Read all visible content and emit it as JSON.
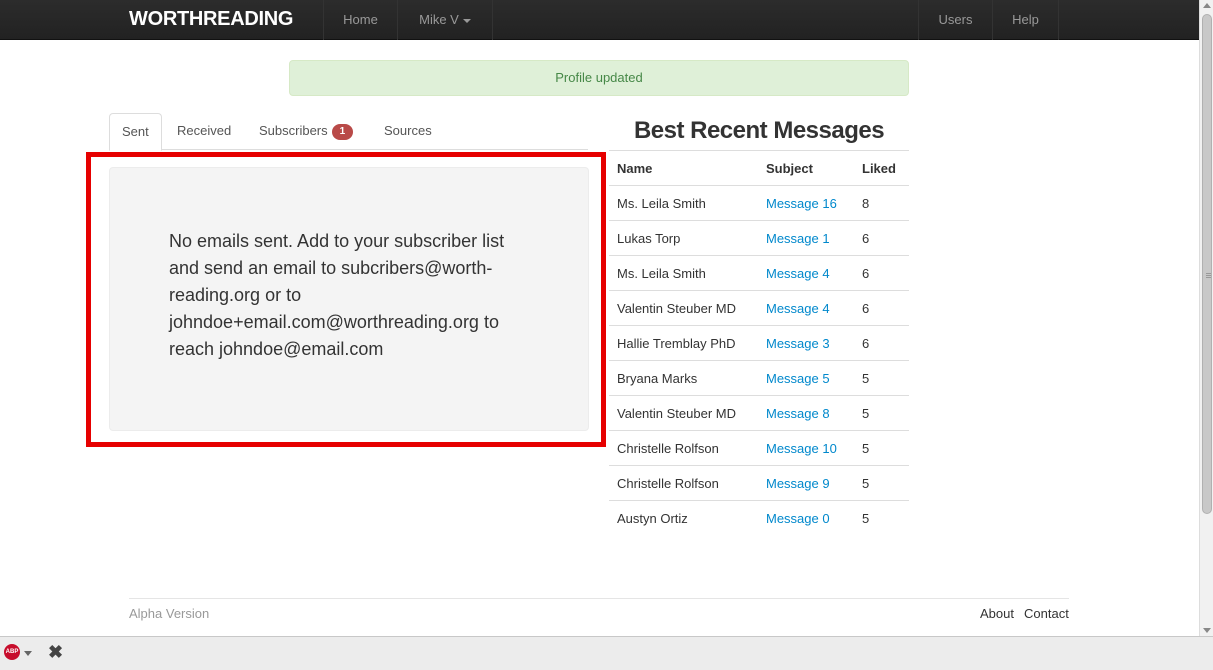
{
  "navbar": {
    "brand": "WORTHREADING",
    "home": "Home",
    "user": "Mike V",
    "users": "Users",
    "help": "Help"
  },
  "alert": {
    "text": "Profile updated"
  },
  "tabs": {
    "sent": "Sent",
    "received": "Received",
    "subscribers": "Subscribers",
    "subscribers_badge": "1",
    "sources": "Sources"
  },
  "sent_panel": {
    "message": "No emails sent. Add to your subscriber list and send an email to subcribers@worth-reading.org or to johndoe+email.com@worthreading.org to reach johndoe@email.com"
  },
  "best_recent": {
    "title": "Best Recent Messages",
    "headers": [
      "Name",
      "Subject",
      "Liked"
    ],
    "rows": [
      {
        "name": "Ms. Leila Smith",
        "subject": "Message 16",
        "liked": "8"
      },
      {
        "name": "Lukas Torp",
        "subject": "Message 1",
        "liked": "6"
      },
      {
        "name": "Ms. Leila Smith",
        "subject": "Message 4",
        "liked": "6"
      },
      {
        "name": "Valentin Steuber MD",
        "subject": "Message 4",
        "liked": "6"
      },
      {
        "name": "Hallie Tremblay PhD",
        "subject": "Message 3",
        "liked": "6"
      },
      {
        "name": "Bryana Marks",
        "subject": "Message 5",
        "liked": "5"
      },
      {
        "name": "Valentin Steuber MD",
        "subject": "Message 8",
        "liked": "5"
      },
      {
        "name": "Christelle Rolfson",
        "subject": "Message 10",
        "liked": "5"
      },
      {
        "name": "Christelle Rolfson",
        "subject": "Message 9",
        "liked": "5"
      },
      {
        "name": "Austyn Ortiz",
        "subject": "Message 0",
        "liked": "5"
      }
    ]
  },
  "footer": {
    "version": "Alpha Version",
    "about": "About",
    "contact": "Contact"
  },
  "addon_bar": {
    "abp_label": "ABP",
    "close_glyph": "✖"
  },
  "colors": {
    "highlight": "#e60000",
    "link": "#0088cc",
    "badge": "#b94a48",
    "alert_bg": "#dff0d8",
    "alert_text": "#468847"
  }
}
